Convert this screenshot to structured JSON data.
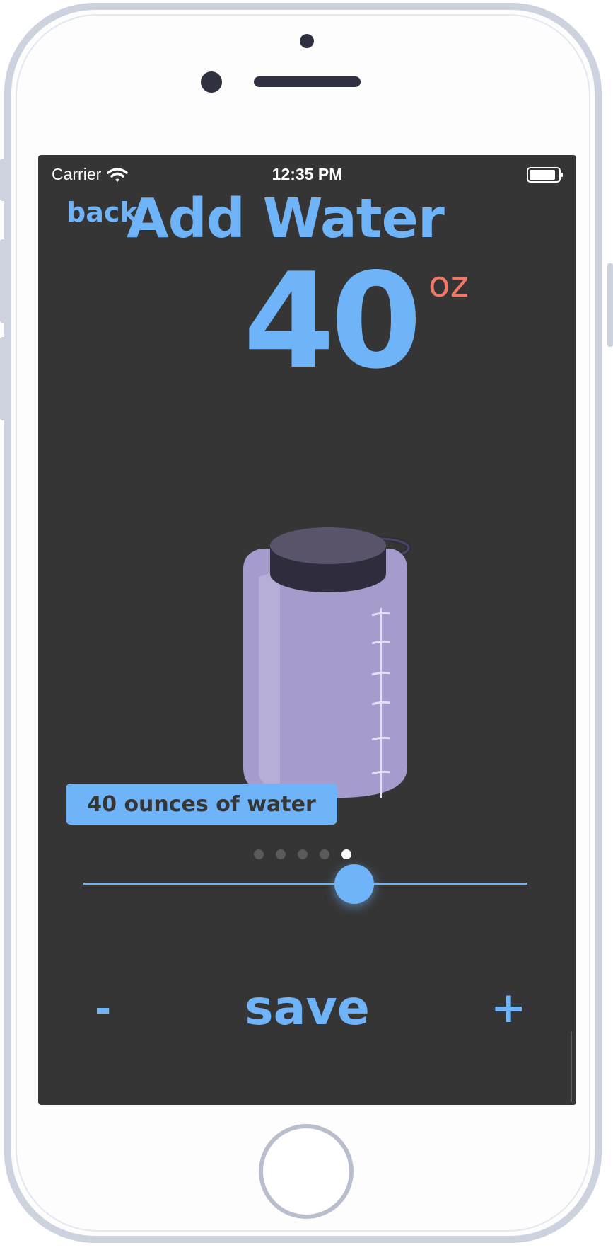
{
  "status_bar": {
    "carrier": "Carrier",
    "time": "12:35 PM"
  },
  "header": {
    "back_label": "back",
    "title": "Add Water"
  },
  "amount": {
    "value": "40",
    "unit": "oz"
  },
  "bottle": {
    "description": "40 ounces of water"
  },
  "pager": {
    "count": 5,
    "active_index": 4
  },
  "slider": {
    "fraction": 0.61
  },
  "controls": {
    "minus_label": "-",
    "save_label": "save",
    "plus_label": "+"
  },
  "colors": {
    "accent": "#6fb3f8",
    "unit": "#f37766",
    "screen_bg": "#353535",
    "bottle": "#a59bcc"
  }
}
